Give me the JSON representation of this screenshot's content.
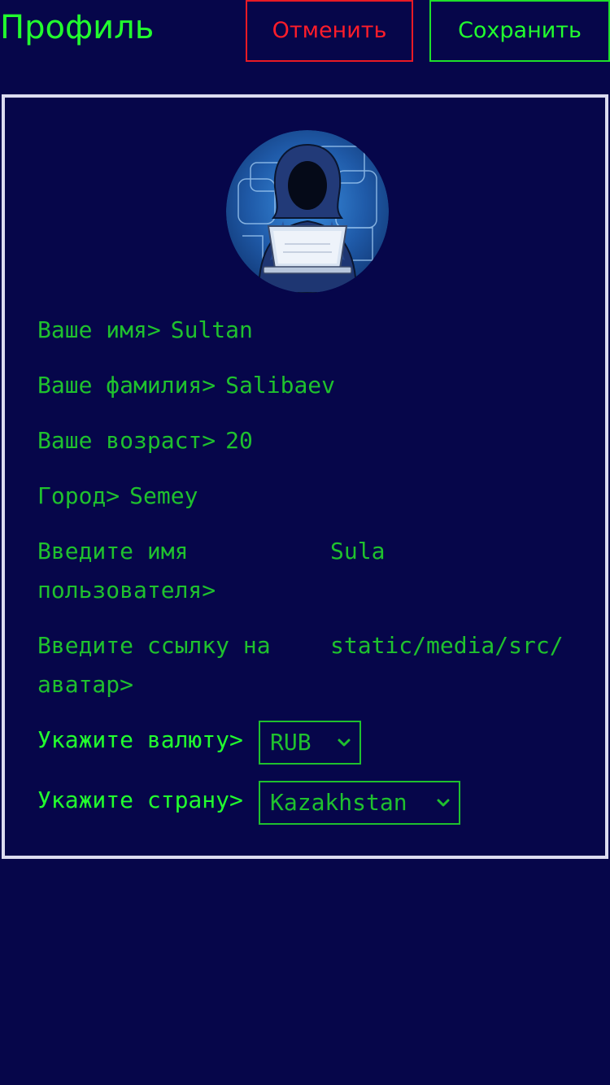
{
  "header": {
    "title": "Профиль",
    "cancel_label": "Отменить",
    "save_label": "Сохранить"
  },
  "profile": {
    "avatar_icon": "hooded-hacker-avatar",
    "first_name": {
      "label": "Ваше имя>",
      "value": "Sultan"
    },
    "last_name": {
      "label": "Ваше фамилия>",
      "value": "Salibaev"
    },
    "age": {
      "label": "Ваше возраст>",
      "value": "20"
    },
    "city": {
      "label": "Город>",
      "value": "Semey"
    },
    "username": {
      "label": "Введите имя пользователя>",
      "value": "Sula"
    },
    "avatar_link": {
      "label": "Введите ссылку на аватар>",
      "value": "static/media/src/"
    },
    "currency": {
      "label": "Укажите валюту>",
      "selected": "RUB"
    },
    "country": {
      "label": "Укажите страну>",
      "selected": "Kazakhstan"
    }
  },
  "colors": {
    "background": "#06064a",
    "accent_green": "#22ff2e",
    "text_green": "#1fc12e",
    "cancel_red": "#ff1d2a",
    "card_border": "#dcdcf0"
  }
}
